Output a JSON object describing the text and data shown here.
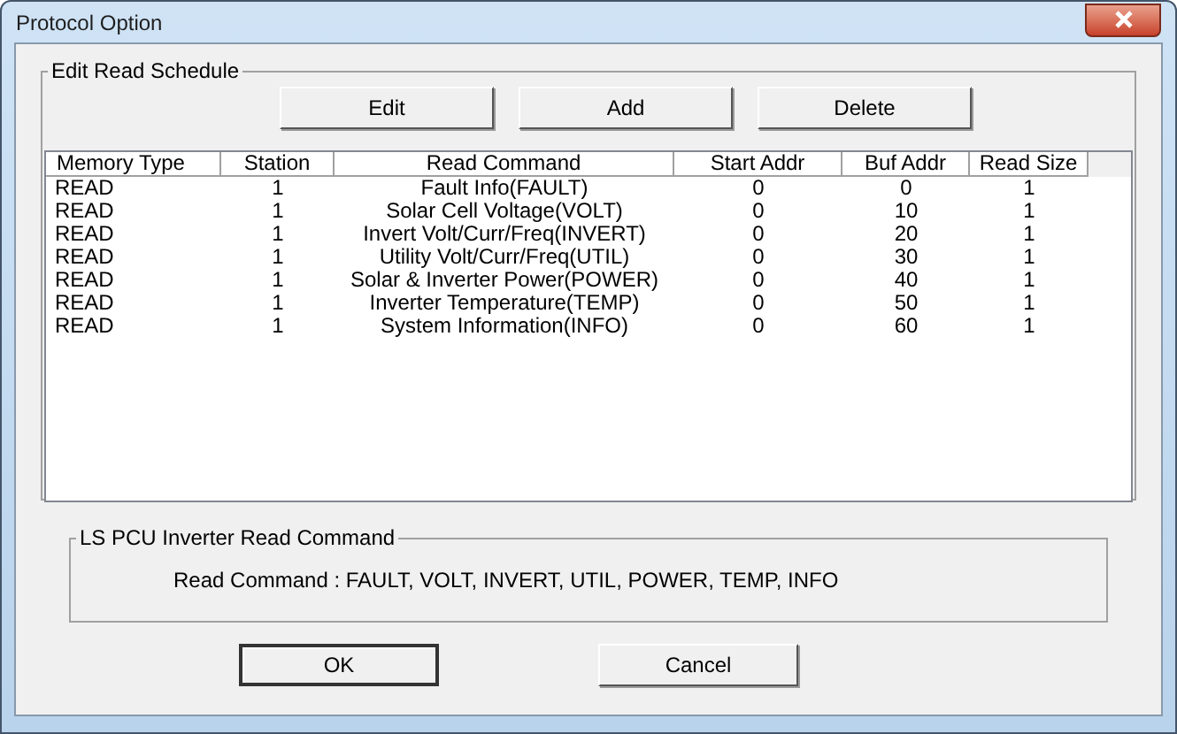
{
  "window": {
    "title": "Protocol Option"
  },
  "schedule": {
    "title": "Edit Read Schedule",
    "buttons": [
      "Edit",
      "Add",
      "Delete"
    ],
    "columns": [
      "Memory Type",
      "Station",
      "Read Command",
      "Start Addr",
      "Buf Addr",
      "Read Size"
    ],
    "rows": [
      [
        "READ",
        "1",
        "Fault Info(FAULT)",
        "0",
        "0",
        "1"
      ],
      [
        "READ",
        "1",
        "Solar Cell Voltage(VOLT)",
        "0",
        "10",
        "1"
      ],
      [
        "READ",
        "1",
        "Invert Volt/Curr/Freq(INVERT)",
        "0",
        "20",
        "1"
      ],
      [
        "READ",
        "1",
        "Utility Volt/Curr/Freq(UTIL)",
        "0",
        "30",
        "1"
      ],
      [
        "READ",
        "1",
        "Solar & Inverter Power(POWER)",
        "0",
        "40",
        "1"
      ],
      [
        "READ",
        "1",
        "Inverter Temperature(TEMP)",
        "0",
        "50",
        "1"
      ],
      [
        "READ",
        "1",
        "System Information(INFO)",
        "0",
        "60",
        "1"
      ]
    ]
  },
  "info": {
    "title": "LS PCU Inverter Read Command",
    "text": "Read Command : FAULT, VOLT, INVERT, UTIL, POWER, TEMP, INFO"
  },
  "footer_buttons": [
    {
      "label": "OK",
      "default": true
    },
    {
      "label": "Cancel",
      "default": false
    }
  ]
}
